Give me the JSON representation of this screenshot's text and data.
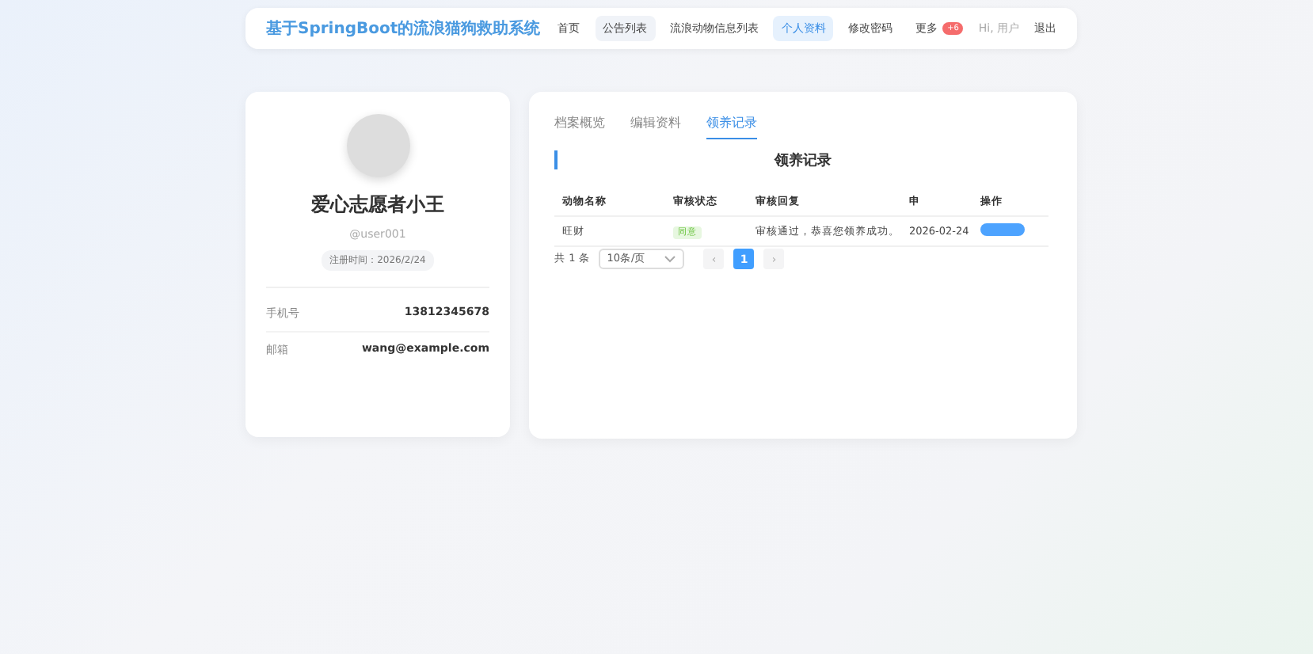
{
  "header": {
    "logo": "基于SpringBoot的流浪猫狗救助系统",
    "nav": [
      {
        "label": "首页",
        "selected": false,
        "hover": false
      },
      {
        "label": "公告列表",
        "selected": false,
        "hover": true
      },
      {
        "label": "流浪动物信息列表",
        "selected": false,
        "hover": false
      },
      {
        "label": "个人资料",
        "selected": true,
        "hover": false
      },
      {
        "label": "修改密码",
        "selected": false,
        "hover": false
      }
    ],
    "more": {
      "label": "更多",
      "badge": "+6"
    },
    "greeting": "Hi, 用户",
    "logout": "退出"
  },
  "profile": {
    "name": "爱心志愿者小王",
    "username": "@user001",
    "registered": "注册时间：2026/2/24",
    "fields": [
      {
        "label": "手机号",
        "value": "13812345678"
      },
      {
        "label": "邮箱",
        "value": "wang@example.com"
      }
    ]
  },
  "tabs": [
    {
      "label": "档案概览",
      "selected": false
    },
    {
      "label": "编辑资料",
      "selected": false
    },
    {
      "label": "领养记录",
      "selected": true
    }
  ],
  "section_title": "领养记录",
  "table": {
    "columns": [
      "动物名称",
      "审核状态",
      "审核回复",
      "申",
      "操作"
    ],
    "rows": [
      {
        "name": "旺财",
        "status": "同意",
        "reply": "审核通过，恭喜您领养成功。",
        "date": "2026-02-24"
      }
    ]
  },
  "pagination": {
    "total": "共 1 条",
    "page_size": "10条/页",
    "prev": "‹",
    "next": "›",
    "pages": [
      {
        "label": "1",
        "selected": true
      }
    ]
  }
}
